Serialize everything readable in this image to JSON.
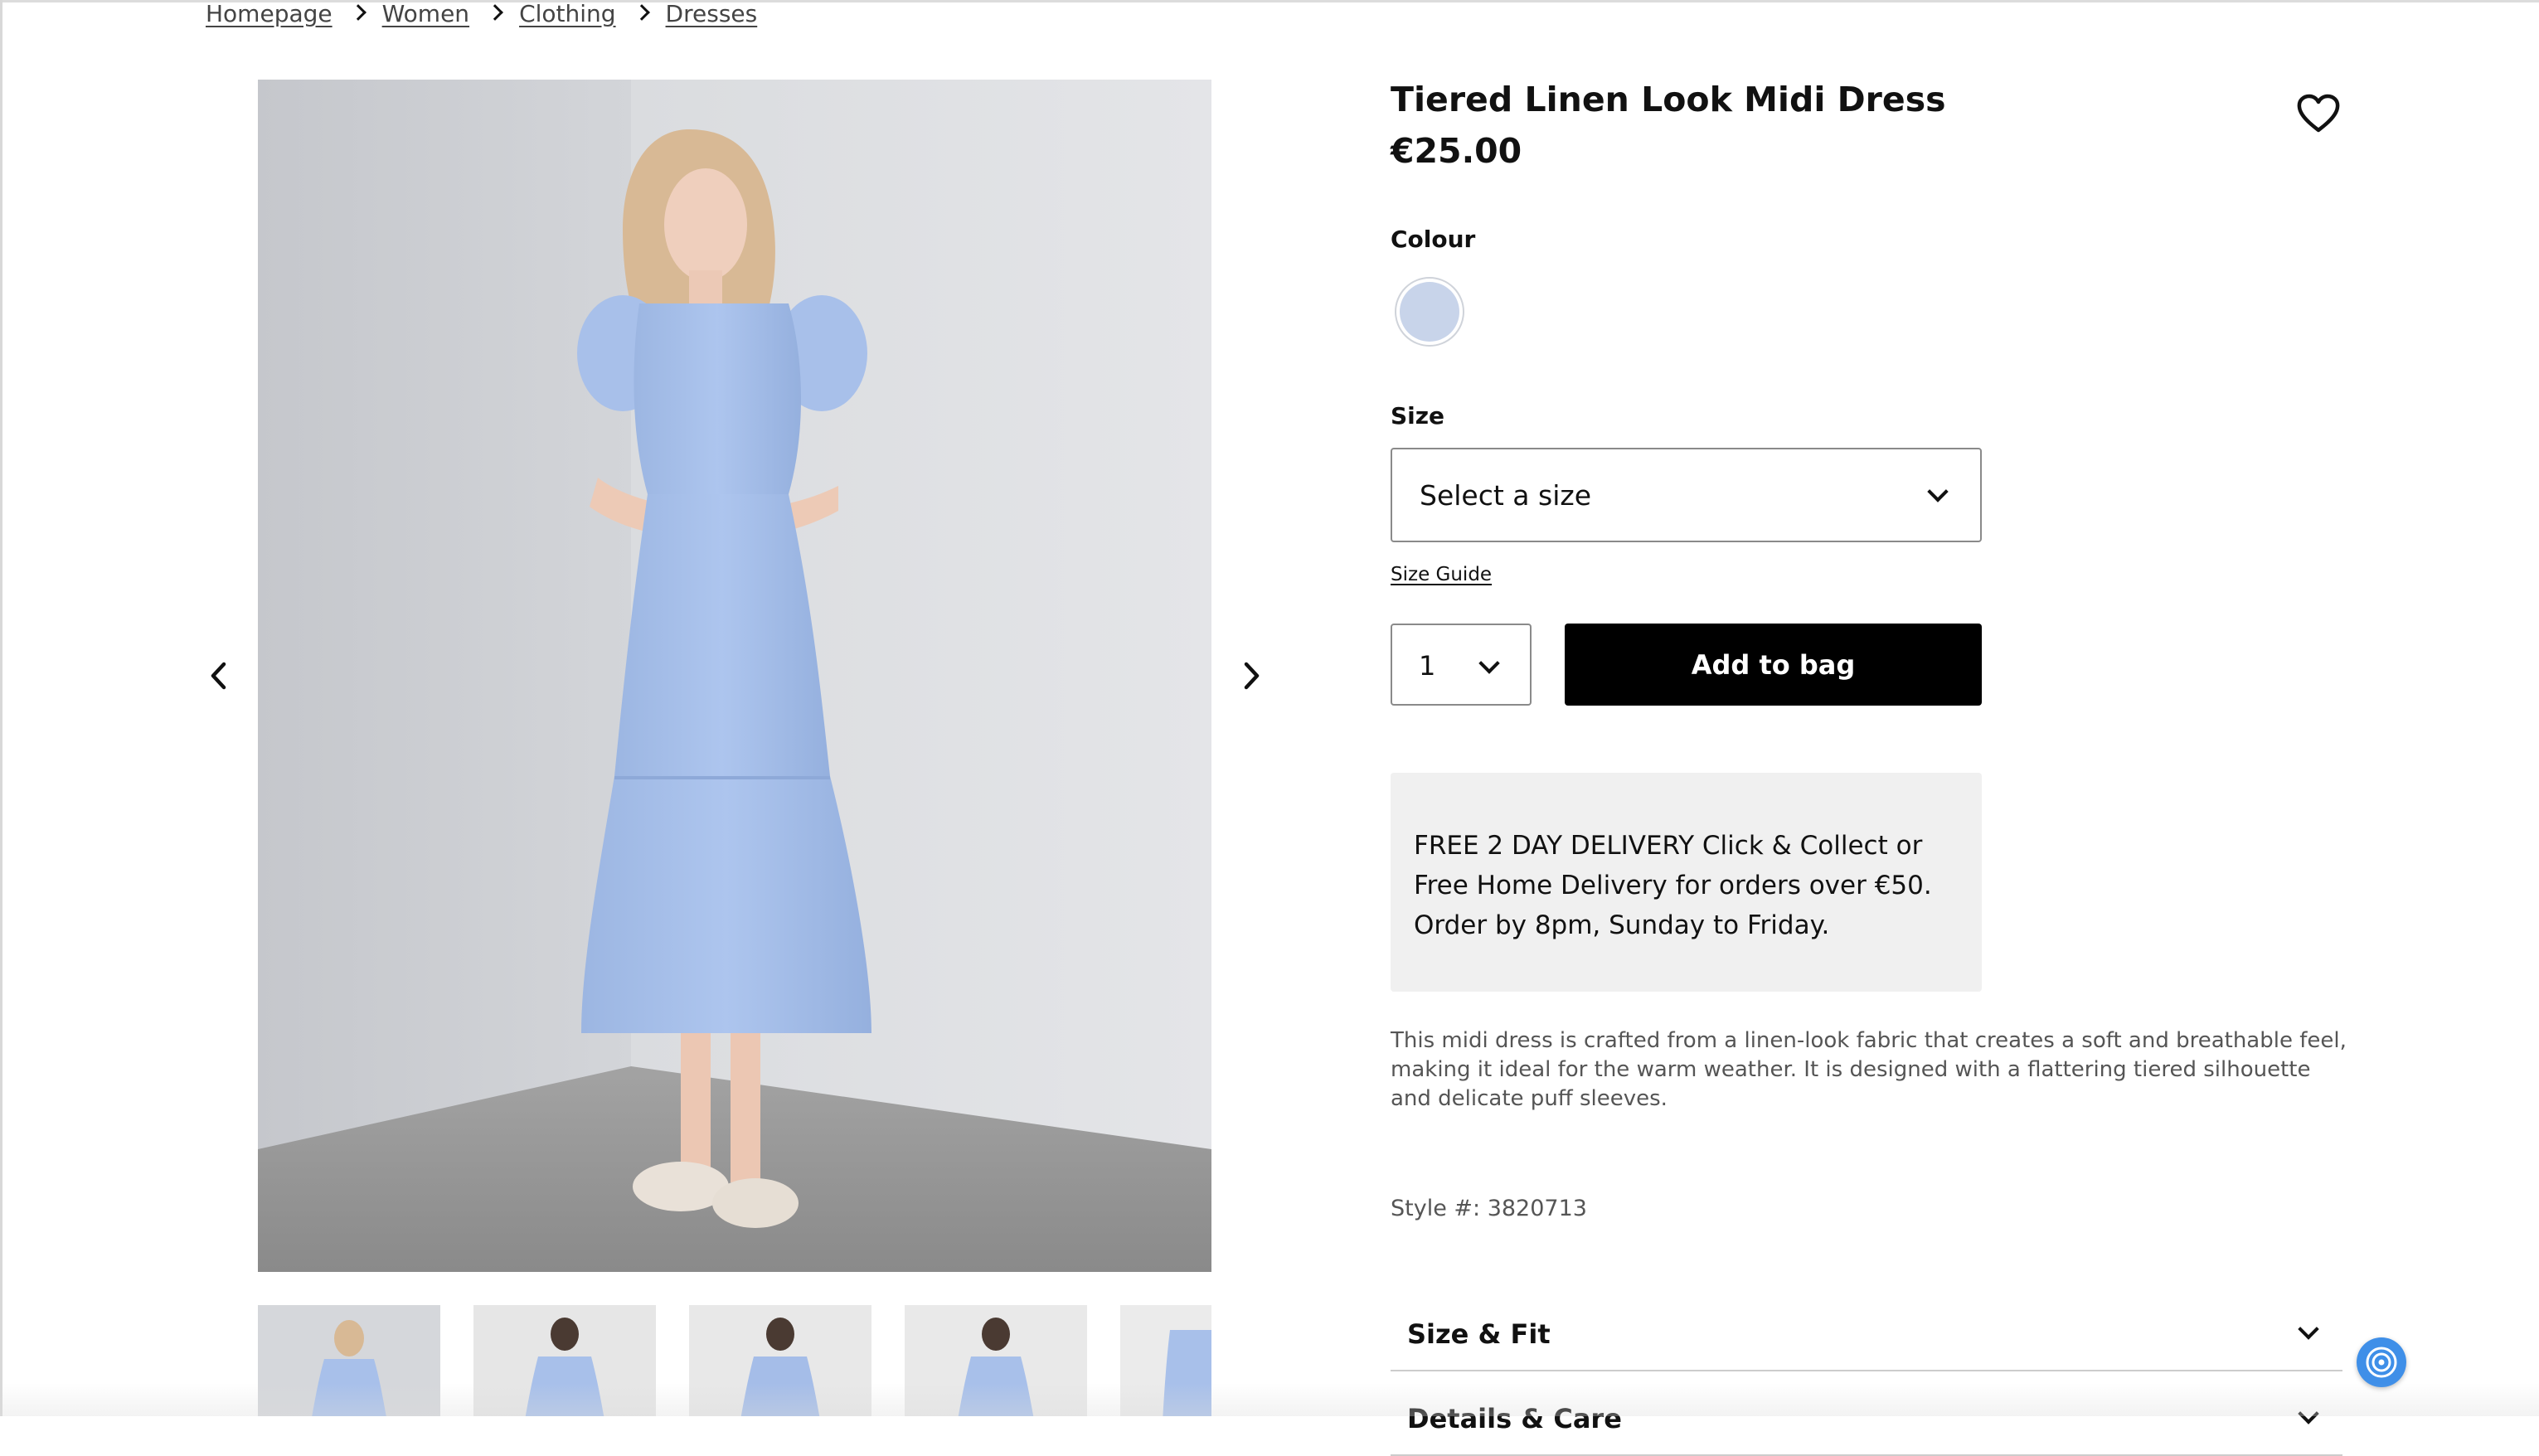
{
  "breadcrumb": {
    "items": [
      "Homepage",
      "Women",
      "Clothing",
      "Dresses"
    ]
  },
  "gallery": {
    "thumbnail_count_visible": 5
  },
  "product": {
    "title": "Tiered Linen Look Midi Dress",
    "price": "€25.00",
    "colour_label": "Colour",
    "colour_swatch": "#c8d4ea",
    "size_label": "Size",
    "size_placeholder": "Select a size",
    "size_guide": "Size Guide",
    "quantity": "1",
    "add_to_bag": "Add to bag",
    "delivery_text": "FREE 2 DAY DELIVERY Click & Collect or Free Home Delivery for orders over €50. Order by 8pm, Sunday to Friday.",
    "description": "This midi dress is crafted from a linen-look fabric that creates a soft and breathable feel, making it ideal for the warm weather. It is designed with a flattering tiered silhouette and delicate puff sleeves.",
    "style_number": "Style #: 3820713"
  },
  "accordions": {
    "size_fit": "Size & Fit",
    "details_care": "Details & Care"
  },
  "icons": {
    "breadcrumb_separator": "chevron-right-icon",
    "wishlist": "heart-icon",
    "prev": "chevron-left-icon",
    "next": "chevron-right-icon",
    "dropdown": "chevron-down-icon",
    "help": "help-chat-icon"
  },
  "colors": {
    "button_bg": "#000000",
    "delivery_bg": "#f0f0f0",
    "dress_blue": "#a9c2ea",
    "help_fab": "#3f8fe8"
  }
}
